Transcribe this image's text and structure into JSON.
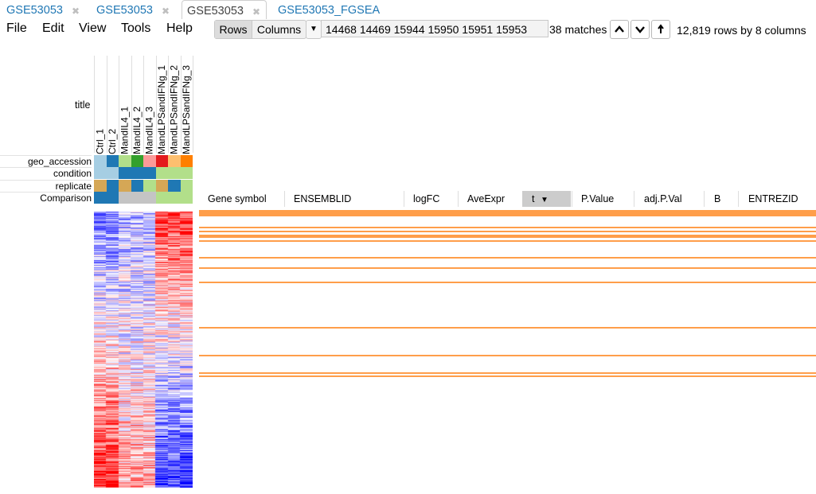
{
  "tabs": [
    {
      "label": "GSE53053",
      "closable": true,
      "active": false
    },
    {
      "label": "GSE53053",
      "closable": true,
      "active": false
    },
    {
      "label": "GSE53053",
      "closable": true,
      "active": true
    },
    {
      "label": "GSE53053_FGSEA",
      "closable": false,
      "active": false
    }
  ],
  "menu": [
    "File",
    "Edit",
    "View",
    "Tools",
    "Help"
  ],
  "toolbar": {
    "rows_label": "Rows",
    "columns_label": "Columns",
    "search_value": "14468 14469 15944 15950 15951 15953",
    "matches": "38 matches",
    "row_count": "12,819 rows by 8 columns"
  },
  "heatmap": {
    "title_label": "title",
    "columns": [
      "Ctrl_1",
      "Ctrl_2",
      "MandIL4_1",
      "MandIL4_2",
      "MandIL4_3",
      "MandLPSandIFNg_1",
      "MandLPSandIFNg_2",
      "MandLPSandIFNg_3"
    ],
    "annotation_rows": [
      {
        "name": "geo_accession",
        "colors": [
          "#a6cee3",
          "#1f78b4",
          "#b2df8a",
          "#33a02c",
          "#fb9a99",
          "#e31a1c",
          "#fdbf6f",
          "#ff7f00"
        ]
      },
      {
        "name": "condition",
        "colors": [
          "#a6cee3",
          "#a6cee3",
          "#1f78b4",
          "#1f78b4",
          "#1f78b4",
          "#b2df8a",
          "#b2df8a",
          "#b2df8a"
        ]
      },
      {
        "name": "replicate",
        "colors": [
          "#d5a756",
          "#1f78b4",
          "#d5a756",
          "#1f78b4",
          "#b2df8a",
          "#d5a756",
          "#1f78b4",
          "#b2df8a"
        ]
      },
      {
        "name": "Comparison",
        "colors": [
          "#1f78b4",
          "#1f78b4",
          "#c4c4c4",
          "#c4c4c4",
          "#c4c4c4",
          "#b2df8a",
          "#b2df8a",
          "#b2df8a"
        ]
      }
    ],
    "color_scale": {
      "high": "#ff0000",
      "mid": "#ffffff",
      "low": "#0000ff"
    }
  },
  "table": {
    "columns": [
      "Gene symbol",
      "ENSEMBLID",
      "logFC",
      "AveExpr",
      "t",
      "P.Value",
      "adj.P.Val",
      "B",
      "ENTREZID"
    ],
    "sorted_column": "t",
    "sort_indicator": "▼",
    "highlight_color": "#ff7f0e"
  }
}
